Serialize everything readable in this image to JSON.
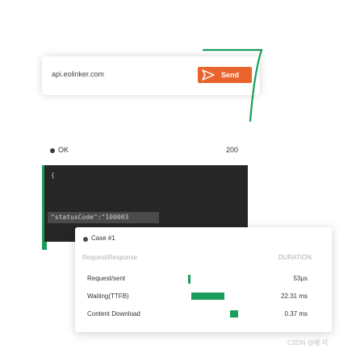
{
  "request": {
    "url": "api.eolinker.com",
    "send_label": "Send"
  },
  "status": {
    "label": "OK",
    "code": "200"
  },
  "response": {
    "brace_open": "{",
    "status_code_text": "\"statusCode\":\"100003"
  },
  "case": {
    "label": "Case #1"
  },
  "timing": {
    "left_header": "Request/Response",
    "right_header": "DURATION",
    "rows": [
      {
        "label": "Request/sent",
        "value": "53μs"
      },
      {
        "label": "Waiting(TTFB)",
        "value": "22.31 ms"
      },
      {
        "label": "Content Download",
        "value": "0.37 ms"
      }
    ]
  },
  "watermark": "CSDN @哪 吒",
  "colors": {
    "send": "#e8642c",
    "green": "#1a9e5c",
    "dark_panel": "#262626"
  }
}
